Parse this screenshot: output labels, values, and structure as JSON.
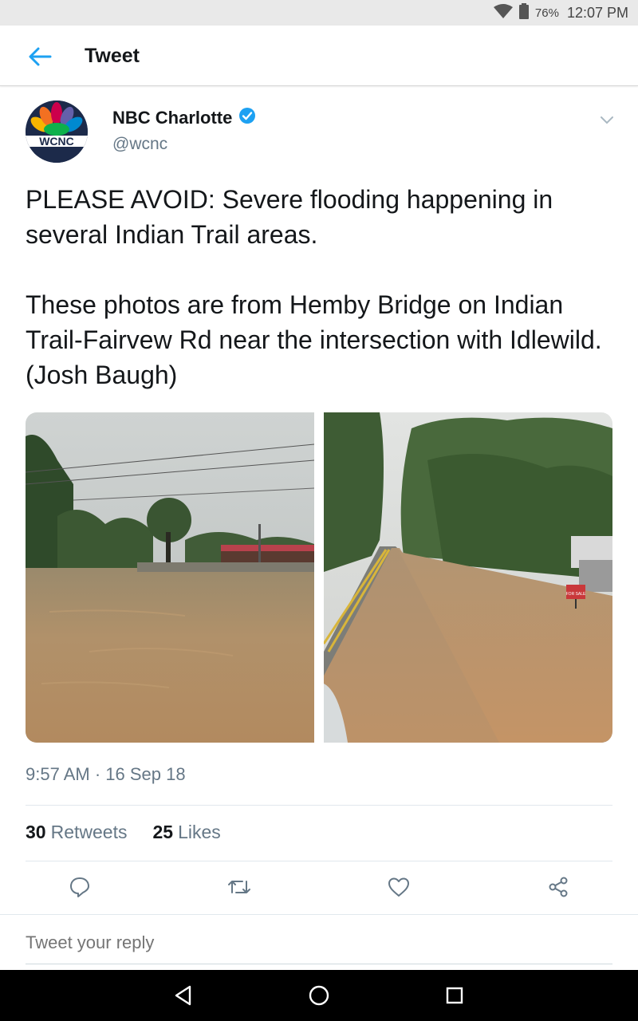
{
  "status_bar": {
    "battery_percent": "76%",
    "time": "12:07 PM",
    "icons": [
      "wifi-icon",
      "battery-icon"
    ]
  },
  "app_bar": {
    "title": "Tweet",
    "back_icon": "arrow-left-icon"
  },
  "tweet": {
    "author": {
      "name": "NBC Charlotte",
      "handle": "@wcnc",
      "verified": true,
      "avatar_text": "WCNC"
    },
    "text": [
      "PLEASE AVOID: Severe flooding happening in several Indian Trail areas.",
      "These photos are from Hemby Bridge on Indian Trail-Fairvew Rd near the intersection with Idlewild. (Josh Baugh)"
    ],
    "photos": [
      {
        "name": "flooded-lot-photo"
      },
      {
        "name": "flooded-road-photo",
        "sign_text": "FOR SALE"
      }
    ],
    "timestamp": "9:57 AM · 16 Sep 18",
    "stats": {
      "retweets_count": "30",
      "retweets_label": "Retweets",
      "likes_count": "25",
      "likes_label": "Likes"
    },
    "actions": [
      "reply-icon",
      "retweet-icon",
      "like-icon",
      "share-icon"
    ]
  },
  "reply": {
    "placeholder": "Tweet your reply"
  },
  "colors": {
    "accent": "#1da1f2",
    "secondary_text": "#657786",
    "status_bar_bg": "#e9e9e9",
    "nav_bar_bg": "#000000"
  }
}
